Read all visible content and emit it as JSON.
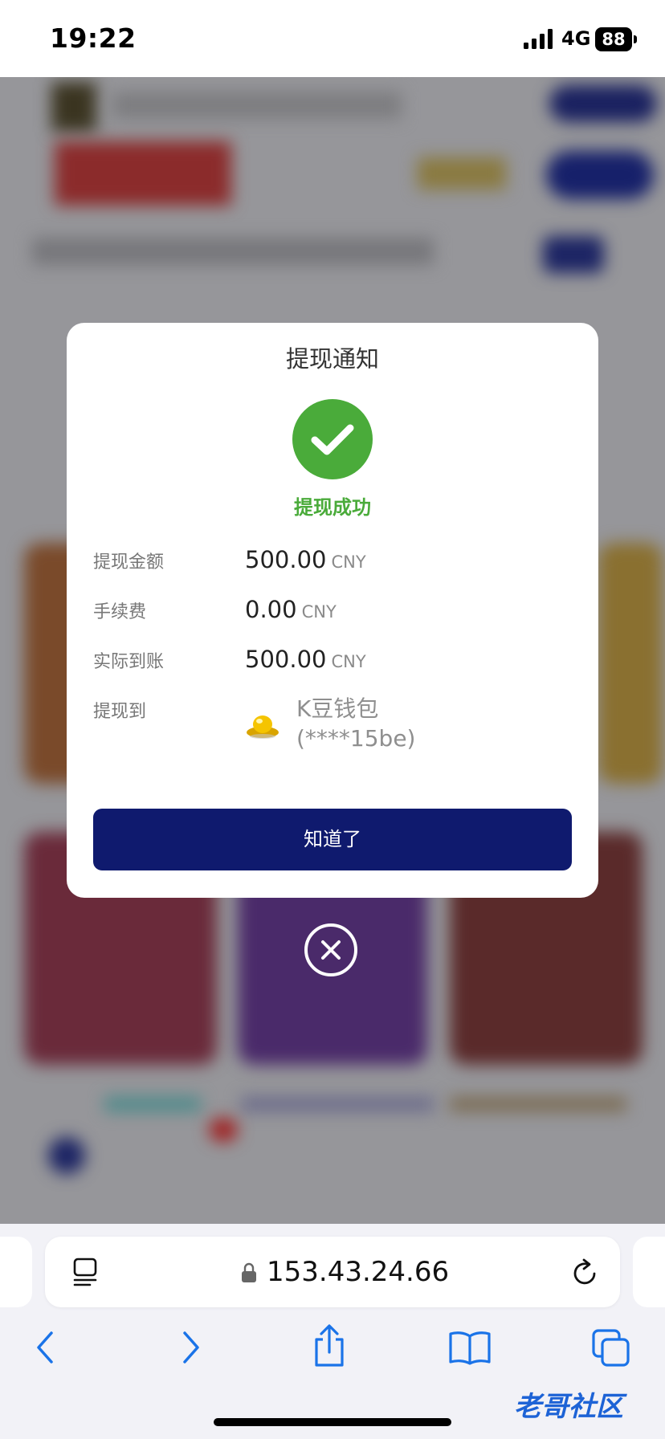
{
  "status_bar": {
    "time": "19:22",
    "network": "4G",
    "battery": "88"
  },
  "modal": {
    "title": "提现通知",
    "status": "提现成功",
    "rows": [
      {
        "label": "提现金额",
        "value": "500.00",
        "unit": "CNY"
      },
      {
        "label": "手续费",
        "value": "0.00",
        "unit": "CNY"
      },
      {
        "label": "实际到账",
        "value": "500.00",
        "unit": "CNY"
      }
    ],
    "destination": {
      "label": "提现到",
      "wallet_name": "K豆钱包",
      "wallet_account": "(****15be)"
    },
    "confirm_label": "知道了"
  },
  "browser": {
    "url": "153.43.24.66"
  },
  "watermark": "老哥社区",
  "colors": {
    "success": "#4aab3a",
    "button": "#0f1a6e"
  }
}
